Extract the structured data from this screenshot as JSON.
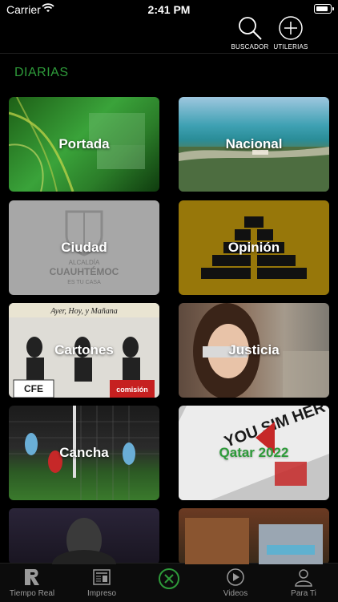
{
  "status": {
    "carrier": "Carrier",
    "time": "2:41 PM"
  },
  "header": {
    "search_label": "BUSCADOR",
    "utilities_label": "UTILERIAS"
  },
  "section": {
    "title": "DIARIAS"
  },
  "tiles": [
    {
      "label": "Portada"
    },
    {
      "label": "Nacional"
    },
    {
      "label": "Ciudad"
    },
    {
      "label": "Opinión"
    },
    {
      "label": "Cartones"
    },
    {
      "label": "Justicia"
    },
    {
      "label": "Cancha"
    },
    {
      "label": "Qatar 2022"
    }
  ],
  "artwork": {
    "ciudad_logo_line1": "ALCALDÍA",
    "ciudad_logo_line2": "CUAUHTÉMOC",
    "ciudad_logo_line3": "ES TU CASA",
    "cartones_banner": "Ayer, Hoy, y Mañana",
    "cartones_sign": "CFE",
    "cartones_sign_sub": "comisión",
    "qatar_sign": "YOU SIM HER"
  },
  "tabbar": {
    "tabs": [
      {
        "label": "Tiempo Real",
        "icon": "r-logo-icon"
      },
      {
        "label": "Impreso",
        "icon": "newspaper-icon"
      },
      {
        "label": "",
        "icon": "close-circle-icon"
      },
      {
        "label": "Videos",
        "icon": "play-circle-icon"
      },
      {
        "label": "Para Ti",
        "icon": "user-icon"
      }
    ]
  },
  "colors": {
    "accent": "#2e9b3a",
    "background": "#000000",
    "tab_inactive": "#9a9a9a"
  }
}
